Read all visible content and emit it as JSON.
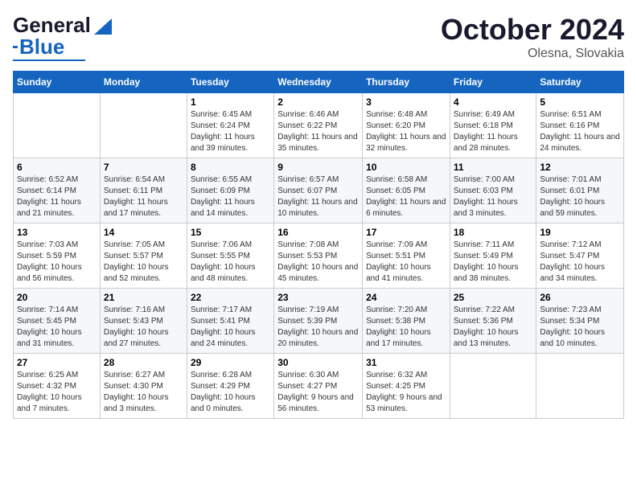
{
  "header": {
    "logo_general": "General",
    "logo_blue": "Blue",
    "month": "October 2024",
    "location": "Olesna, Slovakia"
  },
  "days_of_week": [
    "Sunday",
    "Monday",
    "Tuesday",
    "Wednesday",
    "Thursday",
    "Friday",
    "Saturday"
  ],
  "weeks": [
    [
      {
        "day": "",
        "info": ""
      },
      {
        "day": "",
        "info": ""
      },
      {
        "day": "1",
        "info": "Sunrise: 6:45 AM\nSunset: 6:24 PM\nDaylight: 11 hours and 39 minutes."
      },
      {
        "day": "2",
        "info": "Sunrise: 6:46 AM\nSunset: 6:22 PM\nDaylight: 11 hours and 35 minutes."
      },
      {
        "day": "3",
        "info": "Sunrise: 6:48 AM\nSunset: 6:20 PM\nDaylight: 11 hours and 32 minutes."
      },
      {
        "day": "4",
        "info": "Sunrise: 6:49 AM\nSunset: 6:18 PM\nDaylight: 11 hours and 28 minutes."
      },
      {
        "day": "5",
        "info": "Sunrise: 6:51 AM\nSunset: 6:16 PM\nDaylight: 11 hours and 24 minutes."
      }
    ],
    [
      {
        "day": "6",
        "info": "Sunrise: 6:52 AM\nSunset: 6:14 PM\nDaylight: 11 hours and 21 minutes."
      },
      {
        "day": "7",
        "info": "Sunrise: 6:54 AM\nSunset: 6:11 PM\nDaylight: 11 hours and 17 minutes."
      },
      {
        "day": "8",
        "info": "Sunrise: 6:55 AM\nSunset: 6:09 PM\nDaylight: 11 hours and 14 minutes."
      },
      {
        "day": "9",
        "info": "Sunrise: 6:57 AM\nSunset: 6:07 PM\nDaylight: 11 hours and 10 minutes."
      },
      {
        "day": "10",
        "info": "Sunrise: 6:58 AM\nSunset: 6:05 PM\nDaylight: 11 hours and 6 minutes."
      },
      {
        "day": "11",
        "info": "Sunrise: 7:00 AM\nSunset: 6:03 PM\nDaylight: 11 hours and 3 minutes."
      },
      {
        "day": "12",
        "info": "Sunrise: 7:01 AM\nSunset: 6:01 PM\nDaylight: 10 hours and 59 minutes."
      }
    ],
    [
      {
        "day": "13",
        "info": "Sunrise: 7:03 AM\nSunset: 5:59 PM\nDaylight: 10 hours and 56 minutes."
      },
      {
        "day": "14",
        "info": "Sunrise: 7:05 AM\nSunset: 5:57 PM\nDaylight: 10 hours and 52 minutes."
      },
      {
        "day": "15",
        "info": "Sunrise: 7:06 AM\nSunset: 5:55 PM\nDaylight: 10 hours and 48 minutes."
      },
      {
        "day": "16",
        "info": "Sunrise: 7:08 AM\nSunset: 5:53 PM\nDaylight: 10 hours and 45 minutes."
      },
      {
        "day": "17",
        "info": "Sunrise: 7:09 AM\nSunset: 5:51 PM\nDaylight: 10 hours and 41 minutes."
      },
      {
        "day": "18",
        "info": "Sunrise: 7:11 AM\nSunset: 5:49 PM\nDaylight: 10 hours and 38 minutes."
      },
      {
        "day": "19",
        "info": "Sunrise: 7:12 AM\nSunset: 5:47 PM\nDaylight: 10 hours and 34 minutes."
      }
    ],
    [
      {
        "day": "20",
        "info": "Sunrise: 7:14 AM\nSunset: 5:45 PM\nDaylight: 10 hours and 31 minutes."
      },
      {
        "day": "21",
        "info": "Sunrise: 7:16 AM\nSunset: 5:43 PM\nDaylight: 10 hours and 27 minutes."
      },
      {
        "day": "22",
        "info": "Sunrise: 7:17 AM\nSunset: 5:41 PM\nDaylight: 10 hours and 24 minutes."
      },
      {
        "day": "23",
        "info": "Sunrise: 7:19 AM\nSunset: 5:39 PM\nDaylight: 10 hours and 20 minutes."
      },
      {
        "day": "24",
        "info": "Sunrise: 7:20 AM\nSunset: 5:38 PM\nDaylight: 10 hours and 17 minutes."
      },
      {
        "day": "25",
        "info": "Sunrise: 7:22 AM\nSunset: 5:36 PM\nDaylight: 10 hours and 13 minutes."
      },
      {
        "day": "26",
        "info": "Sunrise: 7:23 AM\nSunset: 5:34 PM\nDaylight: 10 hours and 10 minutes."
      }
    ],
    [
      {
        "day": "27",
        "info": "Sunrise: 6:25 AM\nSunset: 4:32 PM\nDaylight: 10 hours and 7 minutes."
      },
      {
        "day": "28",
        "info": "Sunrise: 6:27 AM\nSunset: 4:30 PM\nDaylight: 10 hours and 3 minutes."
      },
      {
        "day": "29",
        "info": "Sunrise: 6:28 AM\nSunset: 4:29 PM\nDaylight: 10 hours and 0 minutes."
      },
      {
        "day": "30",
        "info": "Sunrise: 6:30 AM\nSunset: 4:27 PM\nDaylight: 9 hours and 56 minutes."
      },
      {
        "day": "31",
        "info": "Sunrise: 6:32 AM\nSunset: 4:25 PM\nDaylight: 9 hours and 53 minutes."
      },
      {
        "day": "",
        "info": ""
      },
      {
        "day": "",
        "info": ""
      }
    ]
  ]
}
